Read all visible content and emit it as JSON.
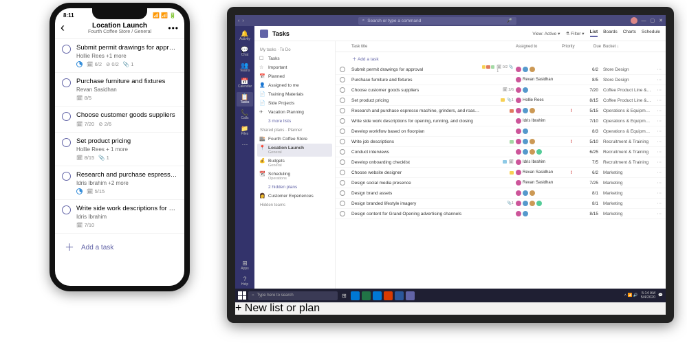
{
  "phone": {
    "time": "8:11",
    "header": {
      "title": "Location Launch",
      "subtitle": "Fourth Coffee Store / General"
    },
    "tasks": [
      {
        "title": "Submit permit drawings for approval",
        "sub": "Hollie Rees +1 more",
        "progress": true,
        "date": "6/2",
        "check": "0/2",
        "attach": "1"
      },
      {
        "title": "Purchase furniture and fixtures",
        "sub": "Revan Sasidhan",
        "date": "8/5"
      },
      {
        "title": "Choose customer goods suppliers",
        "sub": "",
        "date": "7/20",
        "check": "2/6"
      },
      {
        "title": "Set product pricing",
        "sub": "Hollie Rees + 1 more",
        "date": "8/15",
        "attach": "1"
      },
      {
        "title": "Research and purchase espresso...",
        "sub": "Idris Ibrahim +2 more",
        "progress": true,
        "date": "5/15"
      },
      {
        "title": "Write side work descriptions for op...",
        "sub": "Idris Ibrahim",
        "date": "7/10"
      }
    ],
    "add": "Add a task"
  },
  "tablet": {
    "search_placeholder": "Search or type a command",
    "rail": [
      {
        "icon": "🔔",
        "label": "Activity"
      },
      {
        "icon": "💬",
        "label": "Chat"
      },
      {
        "icon": "👥",
        "label": "Teams"
      },
      {
        "icon": "📅",
        "label": "Calendar"
      },
      {
        "icon": "📋",
        "label": "Tasks",
        "active": true
      },
      {
        "icon": "📞",
        "label": "Calls"
      },
      {
        "icon": "📁",
        "label": "Files"
      },
      {
        "icon": "⋯",
        "label": ""
      }
    ],
    "rail_bottom": [
      {
        "icon": "⊞",
        "label": "Apps"
      },
      {
        "icon": "?",
        "label": "Help"
      }
    ],
    "app_title": "Tasks",
    "view_label": "View: Active",
    "filter_label": "Filter",
    "tabs": [
      "List",
      "Boards",
      "Charts",
      "Schedule"
    ],
    "active_tab": "List",
    "side": {
      "h1": "My tasks · To Do",
      "items1": [
        {
          "icon": "☐",
          "label": "Tasks"
        },
        {
          "icon": "☆",
          "label": "Important"
        },
        {
          "icon": "📅",
          "label": "Planned"
        },
        {
          "icon": "👤",
          "label": "Assigned to me"
        },
        {
          "icon": "📄",
          "label": "Training Materials"
        },
        {
          "icon": "📄",
          "label": "Side Projects"
        },
        {
          "icon": "✈",
          "label": "Vacation Planning"
        }
      ],
      "more1": "3 more lists",
      "h2": "Shared plans · Planner",
      "items2": [
        {
          "icon": "🏬",
          "label": "Fourth Coffee Store"
        },
        {
          "icon": "📍",
          "label": "Location Launch",
          "sub": "General",
          "selected": true
        },
        {
          "icon": "💰",
          "label": "Budgets",
          "sub": "General"
        },
        {
          "icon": "📆",
          "label": "Scheduling",
          "sub": "Operations"
        }
      ],
      "more2": "2 hidden plans",
      "items3": [
        {
          "icon": "👩",
          "label": "Customer Experiences"
        }
      ],
      "h3": "Hidden teams",
      "add": "+  New list or plan"
    },
    "columns": {
      "title": "Task title",
      "assigned": "Assigned to",
      "priority": "Priority",
      "due": "Due",
      "bucket": "Bucket"
    },
    "add_task": "Add a task",
    "rows": [
      {
        "title": "Submit permit drawings for approval",
        "tags": [
          "#f7d154",
          "#e07a5f",
          "#a3d9a5"
        ],
        "icons": "🗓 0/2 📎1",
        "assignees": 3,
        "name": "",
        "priority": "",
        "due": "6/2",
        "bucket": "Store Design"
      },
      {
        "title": "Purchase furniture and fixtures",
        "tags": [],
        "assignees": 1,
        "name": "Revan Sasidhan",
        "priority": "",
        "due": "8/5",
        "bucket": "Store Design"
      },
      {
        "title": "Choose customer goods suppliers",
        "tags": [],
        "icons": "🗓 2/6",
        "assignees": 2,
        "name": "",
        "priority": "",
        "due": "7/20",
        "bucket": "Coffee Product Line & Cust..."
      },
      {
        "title": "Set product pricing",
        "tags": [
          "#f7d154"
        ],
        "icons": "📎1",
        "assignees": 1,
        "name": "Hollie Rees",
        "priority": "",
        "due": "8/15",
        "bucket": "Coffee Product Line & Cust..."
      },
      {
        "title": "Research and purchase espresso machine, grinders, and roaster",
        "tags": [
          "#e07a5f"
        ],
        "assignees": 3,
        "name": "",
        "priority": "!",
        "due": "5/15",
        "bucket": "Operations & Equipment"
      },
      {
        "title": "Write side work descriptions for opening, running, and closing",
        "tags": [],
        "assignees": 1,
        "name": "Idris Ibrahim",
        "priority": "",
        "due": "7/10",
        "bucket": "Operations & Equipment"
      },
      {
        "title": "Develop workflow based on floorplan",
        "tags": [],
        "assignees": 2,
        "name": "",
        "priority": "",
        "due": "8/3",
        "bucket": "Operations & Equipment"
      },
      {
        "title": "Write job descriptions",
        "tags": [
          "#a3d9a5"
        ],
        "assignees": 3,
        "name": "",
        "priority": "!",
        "due": "5/10",
        "bucket": "Recruitment & Training"
      },
      {
        "title": "Conduct interviews",
        "tags": [],
        "assignees": 4,
        "name": "",
        "priority": "",
        "due": "6/25",
        "bucket": "Recruitment & Training"
      },
      {
        "title": "Develop onboarding checklist",
        "tags": [
          "#8ecae6"
        ],
        "icons": "🗓",
        "assignees": 1,
        "name": "Idris Ibrahim",
        "priority": "",
        "due": "7/5",
        "bucket": "Recruitment & Training"
      },
      {
        "title": "Choose website designer",
        "tags": [
          "#f7d154"
        ],
        "assignees": 1,
        "name": "Revan Sasidhan",
        "priority": "!",
        "due": "6/2",
        "bucket": "Marketing"
      },
      {
        "title": "Design social media presence",
        "tags": [],
        "assignees": 1,
        "name": "Revan Sasidhan",
        "priority": "",
        "due": "7/25",
        "bucket": "Marketing"
      },
      {
        "title": "Design brand assets",
        "tags": [],
        "assignees": 3,
        "name": "",
        "priority": "",
        "due": "8/1",
        "bucket": "Marketing"
      },
      {
        "title": "Design branded lifestyle imagery",
        "tags": [],
        "icons": "📎1",
        "assignees": 4,
        "name": "",
        "priority": "",
        "due": "8/1",
        "bucket": "Marketing"
      },
      {
        "title": "Design content for Grand Opening advertising channels",
        "tags": [],
        "assignees": 2,
        "name": "",
        "priority": "",
        "due": "8/15",
        "bucket": "Marketing"
      }
    ],
    "taskbar": {
      "search": "Type here to search",
      "time": "5:14 AM",
      "date": "5/4/2020"
    }
  }
}
